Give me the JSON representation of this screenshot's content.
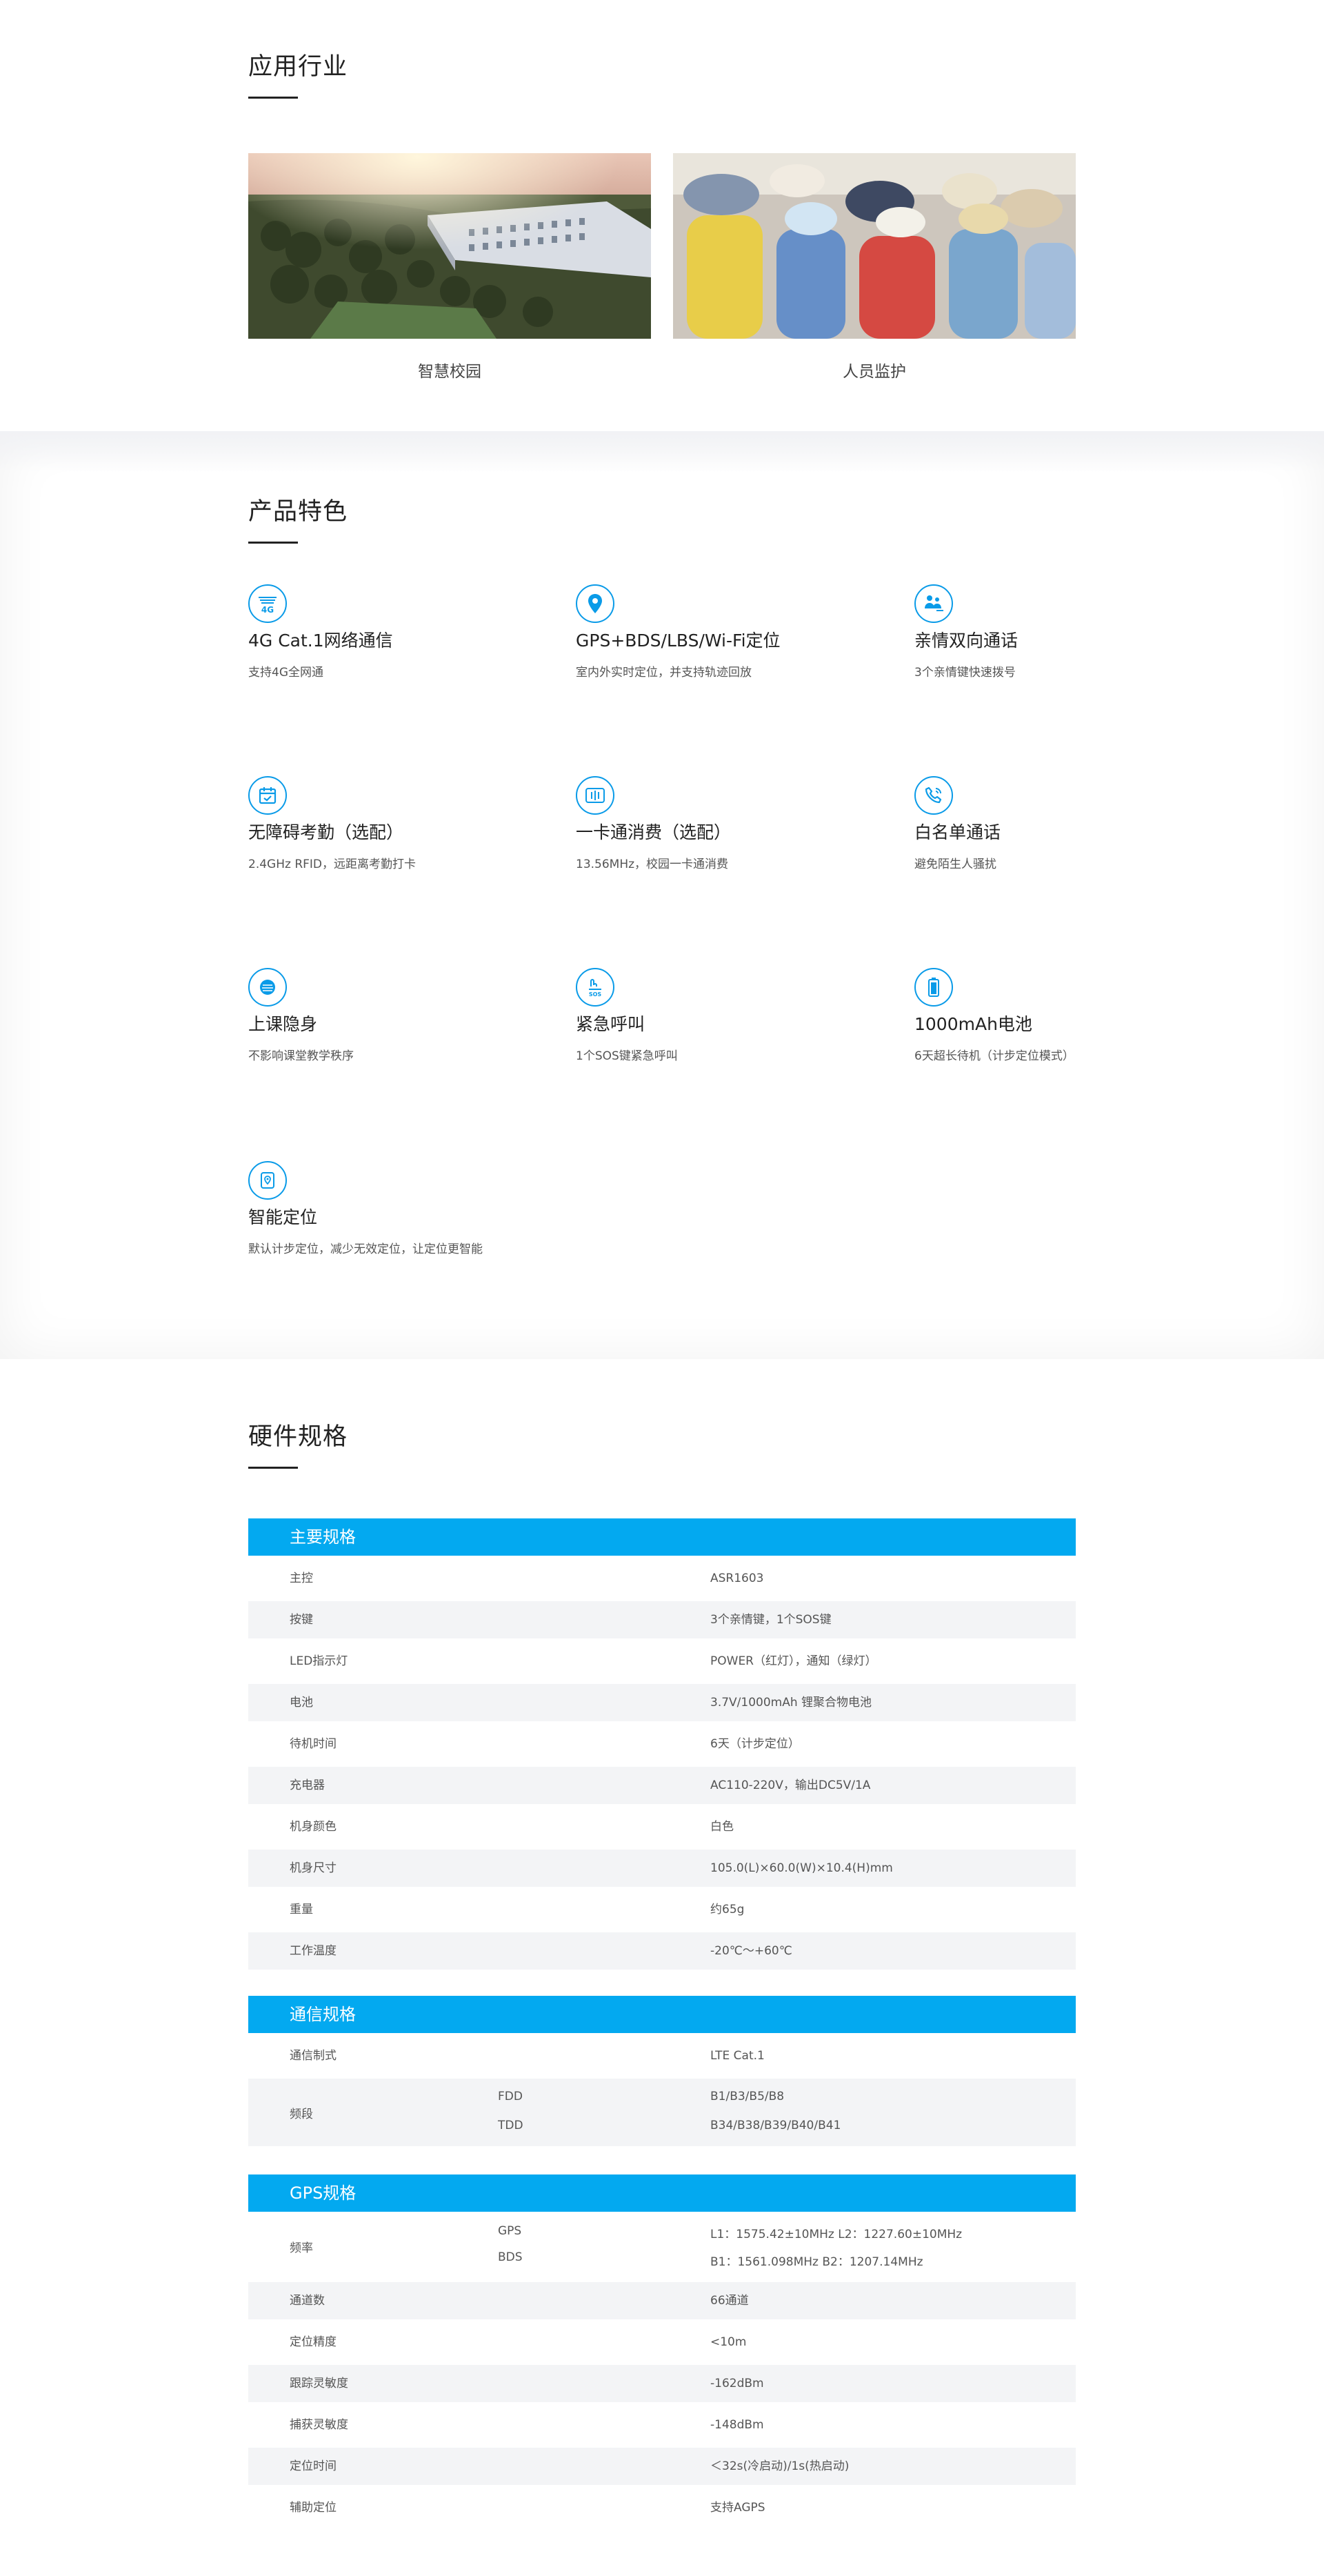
{
  "apps": {
    "title": "应用行业",
    "items": [
      {
        "caption": "智慧校园"
      },
      {
        "caption": "人员监护"
      }
    ]
  },
  "features": {
    "title": "产品特色",
    "items": [
      {
        "icon": "4g-icon",
        "name": "4G Cat.1网络通信",
        "desc": "支持4G全网通"
      },
      {
        "icon": "location-pin-icon",
        "name": "GPS+BDS/LBS/Wi-Fi定位",
        "desc": "室内外实时定位，并支持轨迹回放"
      },
      {
        "icon": "family-call-icon",
        "name": "亲情双向通话",
        "desc": "3个亲情键快速拨号"
      },
      {
        "icon": "calendar-check-icon",
        "name": "无障碍考勤（选配）",
        "desc": "2.4GHz RFID，远距离考勤打卡"
      },
      {
        "icon": "nfc-card-icon",
        "name": "一卡通消费（选配）",
        "desc": "13.56MHz，校园一卡通消费"
      },
      {
        "icon": "phone-whitelist-icon",
        "name": "白名单通话",
        "desc": "避免陌生人骚扰"
      },
      {
        "icon": "class-mode-icon",
        "name": "上课隐身",
        "desc": "不影响课堂教学秩序"
      },
      {
        "icon": "sos-icon",
        "name": "紧急呼叫",
        "desc": "1个SOS键紧急呼叫"
      },
      {
        "icon": "battery-icon",
        "name": "1000mAh电池",
        "desc": "6天超长待机（计步定位模式）"
      },
      {
        "icon": "smart-location-icon",
        "name": "智能定位",
        "desc": "默认计步定位，减少无效定位，让定位更智能"
      }
    ]
  },
  "specs": {
    "title": "硬件规格",
    "main": {
      "header": "主要规格",
      "rows": [
        {
          "key": "主控",
          "value": "ASR1603"
        },
        {
          "key": "按键",
          "value": "3个亲情键，1个SOS键"
        },
        {
          "key": "LED指示灯",
          "value": "POWER（红灯），通知（绿灯）"
        },
        {
          "key": "电池",
          "value": "3.7V/1000mAh 锂聚合物电池"
        },
        {
          "key": "待机时间",
          "value": "6天（计步定位）"
        },
        {
          "key": "充电器",
          "value": "AC110-220V，输出DC5V/1A"
        },
        {
          "key": "机身颜色",
          "value": "白色"
        },
        {
          "key": "机身尺寸",
          "value": "105.0(L)×60.0(W)×10.4(H)mm"
        },
        {
          "key": "重量",
          "value": "约65g"
        },
        {
          "key": "工作温度",
          "value": "-20℃～+60℃"
        }
      ]
    },
    "comm": {
      "header": "通信规格",
      "standard": {
        "key": "通信制式",
        "value": "LTE Cat.1"
      },
      "band": {
        "key": "频段",
        "sub1": "FDD",
        "val1": "B1/B3/B5/B8",
        "sub2": "TDD",
        "val2": "B34/B38/B39/B40/B41"
      }
    },
    "gps": {
      "header": "GPS规格",
      "freq": {
        "key": "频率",
        "sub1": "GPS",
        "val1": "L1：1575.42±10MHz  L2：1227.60±10MHz",
        "sub2": "BDS",
        "val2": "B1：1561.098MHz  B2：1207.14MHz"
      },
      "rows": [
        {
          "key": "通道数",
          "value": "66通道"
        },
        {
          "key": "定位精度",
          "value": "<10m"
        },
        {
          "key": "跟踪灵敏度",
          "value": "-162dBm"
        },
        {
          "key": "捕获灵敏度",
          "value": "-148dBm"
        },
        {
          "key": "定位时间",
          "value": "＜32s(冷启动)/1s(热启动)"
        },
        {
          "key": "辅助定位",
          "value": "支持AGPS"
        }
      ]
    }
  }
}
